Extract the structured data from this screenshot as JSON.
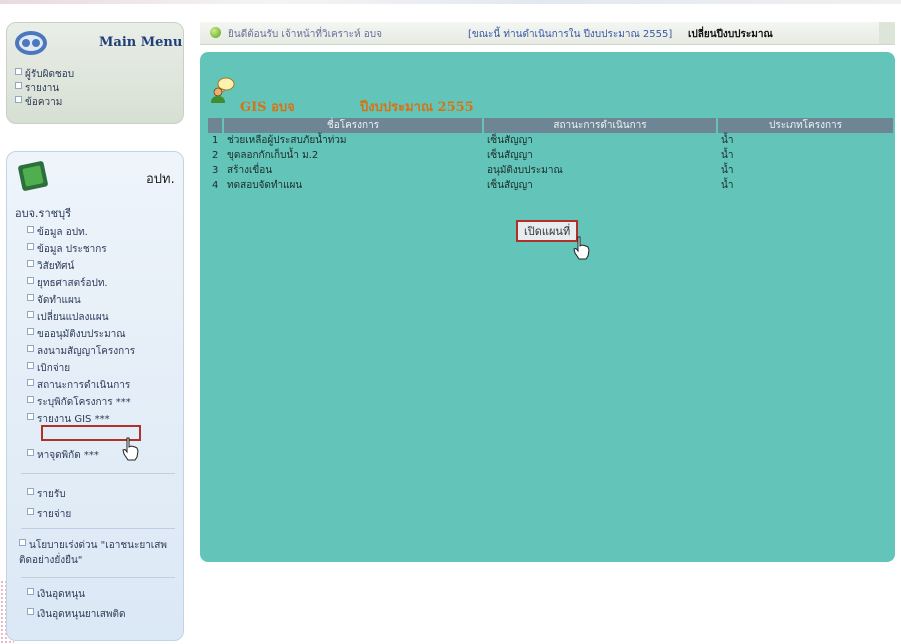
{
  "main_menu": {
    "title": "Main Menu",
    "items": [
      "ผู้รับผิดชอบ",
      "รายงาน",
      "ข้อความ"
    ]
  },
  "org_panel": {
    "title": "อปท.",
    "province": "อบจ.ราชบุรี",
    "items": [
      "ข้อมูล อปท.",
      "ข้อมูล ประชากร",
      "วิสัยทัศน์",
      "ยุทธศาสตร์อปท.",
      "จัดทำแผน",
      "เปลี่ยนแปลงแผน",
      "ขออนุมัติงบประมาณ",
      "ลงนามสัญญาโครงการ",
      "เบิกจ่าย",
      "สถานะการดำเนินการ",
      "ระบุพิกัดโครงการ ***",
      "รายงาน GIS ***",
      "หาจุดพิกัด ***"
    ],
    "items2": [
      "รายรับ",
      "รายจ่าย"
    ],
    "items3": [
      "นโยบายเร่งด่วน \"เอาชนะยาเสพติดอย่างยั่งยืน\""
    ],
    "items4": [
      "เงินอุดหนุน",
      "เงินอุดหนุนยาเสพติด"
    ]
  },
  "topbar": {
    "welcome": "ยินดีต้อนรับ เจ้าหน้าที่วิเคราะห์ อบจ",
    "year_text": "[ขณะนี้ ท่านดำเนินการใน ปีงบประมาณ 2555]",
    "change_year": "เปลี่ยนปีงบประมาณ"
  },
  "gis": {
    "title": "GIS อบจ",
    "year": "ปีงบประมาณ 2555",
    "columns": [
      "ชื่อโครงการ",
      "สถานะการดำเนินการ",
      "ประเภทโครงการ"
    ],
    "rows": [
      {
        "no": "1",
        "name": "ช่วยเหลือผู้ประสบภัยน้ำท่วม",
        "status": "เซ็นสัญญา",
        "type": "น้ำ"
      },
      {
        "no": "2",
        "name": "ขุดลอกกักเก็บน้ำ ม.2",
        "status": "เซ็นสัญญา",
        "type": "น้ำ"
      },
      {
        "no": "3",
        "name": "สร้างเขื่อน",
        "status": "อนุมัติงบประมาณ",
        "type": "น้ำ"
      },
      {
        "no": "4",
        "name": "ทดสอบจัดทำแผน",
        "status": "เซ็นสัญญา",
        "type": "น้ำ"
      }
    ],
    "open_map_button": "เปิดแผนที่"
  },
  "colors": {
    "panel_teal": "#63c5b9",
    "header_gray": "#6e8595",
    "title_orange": "#d67314",
    "highlight_red": "#b0302a"
  },
  "icons": [
    "main-menu-logo-icon",
    "org-logo-icon",
    "gis-user-icon",
    "hand-cursor-icon"
  ]
}
